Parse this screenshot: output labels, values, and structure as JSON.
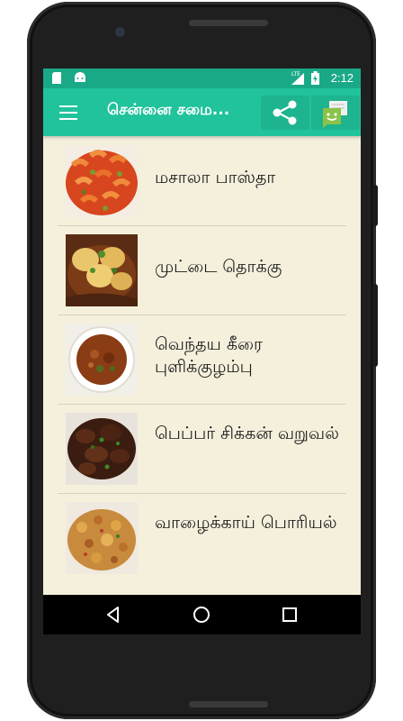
{
  "status_bar": {
    "time": "2:12",
    "network": "LTE",
    "icons": [
      "sim-card-icon",
      "android-icon",
      "signal-icon",
      "battery-charging-icon"
    ]
  },
  "app_bar": {
    "title": "சென்னை சமை...",
    "actions": [
      "share-icon",
      "message-icon"
    ]
  },
  "recipes": [
    {
      "title": "மசாலா பாஸ்தா"
    },
    {
      "title": "முட்டை தொக்கு"
    },
    {
      "title": "வெந்தய கீரை புளிக்குழம்பு"
    },
    {
      "title": "பெப்பர் சிக்கன் வறுவல்"
    },
    {
      "title": "வாழைக்காய் பொரியல்"
    }
  ],
  "nav_bar": {
    "buttons": [
      "back-icon",
      "home-icon",
      "recents-icon"
    ]
  },
  "colors": {
    "status_bar": "#1aa987",
    "app_bar": "#20c39b",
    "list_background": "#f5f0dc",
    "divider": "#d8d2bc"
  }
}
